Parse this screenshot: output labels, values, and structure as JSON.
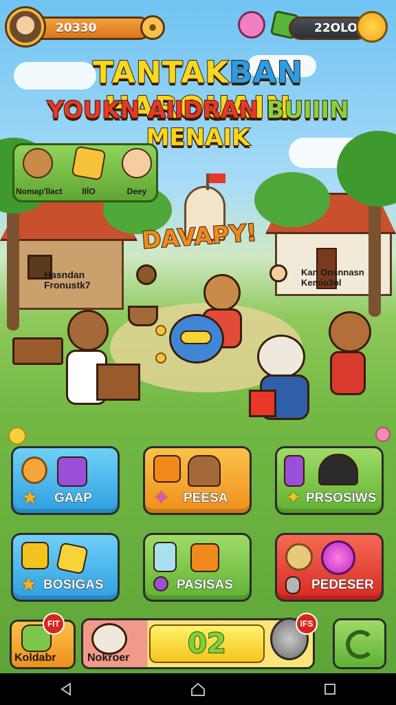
{
  "hud": {
    "left_value": "20З30",
    "right_value": "22OLO"
  },
  "title": {
    "line1_parts": [
      "TANTAK",
      "BAN",
      " HAROUAIN"
    ],
    "line2_parts": [
      "YOUKN ",
      "AIIDRAN ",
      "BUIIIN ",
      "MENAIK"
    ]
  },
  "characters": [
    {
      "label": "Nomap'llact",
      "icon": "bear-face-icon"
    },
    {
      "label": "IIİO",
      "icon": "star-icon"
    },
    {
      "label": "Deey",
      "icon": "farmer-character-icon"
    }
  ],
  "scene": {
    "banner": "DAVAPY!",
    "left_sign": "Hasndan Fronustk7",
    "right_sign": "Kan Onsnnasn Kemio3ol"
  },
  "tiles": [
    {
      "label": "GAAP",
      "color": "#3fb4ec",
      "border": "#1f5f8b"
    },
    {
      "label": "PEESA",
      "color": "#f4a62a",
      "border": "#8a4f0d"
    },
    {
      "label": "PRSOSIWS",
      "color": "#7cc64a",
      "border": "#2f6418"
    },
    {
      "label": "BOSIGAS",
      "color": "#3fb4ec",
      "border": "#1f5f8b"
    },
    {
      "label": "PASISAS",
      "color": "#7cc64a",
      "border": "#2f6418"
    },
    {
      "label": "PEDESER",
      "color": "#e53b30",
      "border": "#7a130e"
    }
  ],
  "bottom": {
    "left_label": "Koldabr",
    "left_badge": "FIT",
    "center_name": "Nokroer",
    "center_value": "02",
    "right_badge": "IFS"
  },
  "colors": {
    "title_yellow": "#f9d71c",
    "title_blue": "#2a9de8",
    "title_red": "#e8382a",
    "title_green": "#8bd13a"
  }
}
